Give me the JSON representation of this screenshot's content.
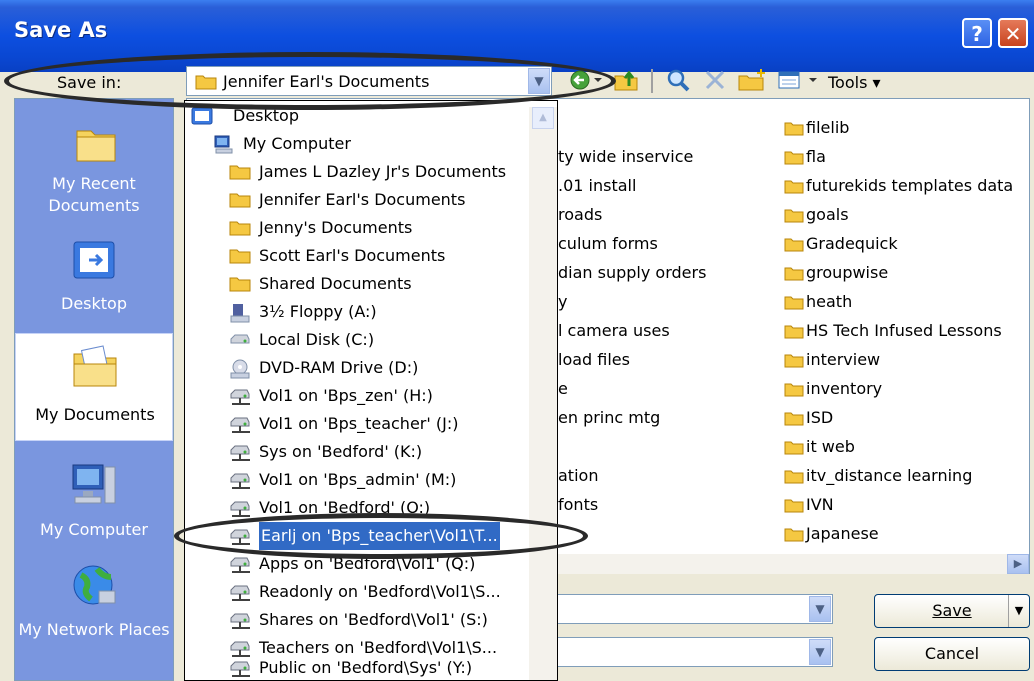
{
  "window": {
    "title": "Save As",
    "help_glyph": "?",
    "close_glyph": "✕"
  },
  "toolbar": {
    "save_in_label": "Save in:",
    "save_in_value": "Jennifer Earl's Documents",
    "tools_label": "Tools"
  },
  "places": [
    {
      "label": "My Recent Documents",
      "icon": "recent-documents-icon"
    },
    {
      "label": "Desktop",
      "icon": "desktop-icon"
    },
    {
      "label": "My Documents",
      "icon": "my-documents-icon"
    },
    {
      "label": "My Computer",
      "icon": "my-computer-icon"
    },
    {
      "label": "My Network Places",
      "icon": "network-places-icon"
    }
  ],
  "files": {
    "col1": [
      "ty wide inservice",
      ".01 install",
      "roads",
      "culum forms",
      "dian supply orders",
      "y",
      "l camera uses",
      "load files",
      "e",
      "en princ mtg",
      "",
      "ation",
      "fonts"
    ],
    "col2": [
      "filelib",
      "fla",
      "futurekids templates data",
      "goals",
      "Gradequick",
      "groupwise",
      "heath",
      "HS Tech Infused Lessons",
      "interview",
      "inventory",
      "ISD",
      "it web",
      "itv_distance learning",
      "IVN",
      "Japanese"
    ]
  },
  "dropdown": [
    {
      "label": "Desktop",
      "icon": "desktop-icon"
    },
    {
      "label": "My Computer",
      "icon": "computer-icon"
    },
    {
      "label": "James L Dazley Jr's Documents",
      "icon": "folder-icon"
    },
    {
      "label": "Jennifer Earl's Documents",
      "icon": "folder-icon"
    },
    {
      "label": "Jenny's Documents",
      "icon": "folder-icon"
    },
    {
      "label": "Scott Earl's Documents",
      "icon": "folder-icon"
    },
    {
      "label": "Shared Documents",
      "icon": "folder-icon"
    },
    {
      "label": "3½ Floppy (A:)",
      "icon": "floppy-icon"
    },
    {
      "label": "Local Disk (C:)",
      "icon": "hard-disk-icon"
    },
    {
      "label": "DVD-RAM Drive (D:)",
      "icon": "dvd-drive-icon"
    },
    {
      "label": "Vol1 on 'Bps_zen' (H:)",
      "icon": "network-drive-icon"
    },
    {
      "label": "Vol1 on 'Bps_teacher' (J:)",
      "icon": "network-drive-icon"
    },
    {
      "label": "Sys on 'Bedford' (K:)",
      "icon": "network-drive-icon"
    },
    {
      "label": "Vol1 on 'Bps_admin' (M:)",
      "icon": "network-drive-icon"
    },
    {
      "label": "Vol1 on 'Bedford' (O:)",
      "icon": "network-drive-icon"
    },
    {
      "label": "Earlj on 'Bps_teacher\\Vol1\\T...",
      "icon": "network-drive-icon",
      "selected": true
    },
    {
      "label": "Apps on 'Bedford\\Vol1' (Q:)",
      "icon": "network-drive-icon"
    },
    {
      "label": "Readonly on 'Bedford\\Vol1\\S...",
      "icon": "network-drive-icon"
    },
    {
      "label": "Shares on 'Bedford\\Vol1' (S:)",
      "icon": "network-drive-icon"
    },
    {
      "label": "Teachers on 'Bedford\\Vol1\\S...",
      "icon": "network-drive-icon"
    },
    {
      "label": "Public on 'Bedford\\Sys' (Y:)",
      "icon": "network-drive-icon"
    }
  ],
  "buttons": {
    "save": "Save",
    "cancel": "Cancel"
  },
  "colors": {
    "title_bar": "#0a47d2",
    "places_bar": "#7a96df",
    "selection": "#316ac5",
    "folder": "#f5c842",
    "dialog_bg": "#ece9d8"
  }
}
